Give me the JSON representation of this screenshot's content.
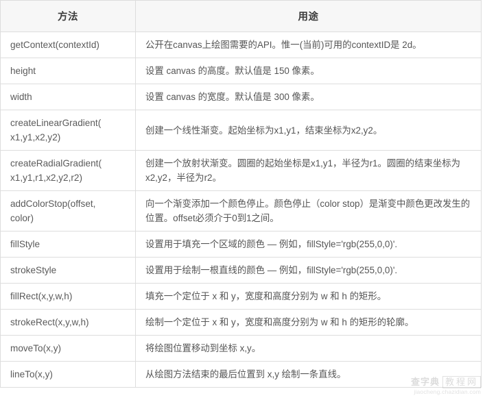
{
  "table": {
    "headers": [
      "方法",
      "用途"
    ],
    "rows": [
      {
        "method": "getContext(contextId)",
        "use": "公开在canvas上绘图需要的API。惟一(当前)可用的contextID是 2d。"
      },
      {
        "method": "height",
        "use": "设置 canvas 的高度。默认值是 150 像素。"
      },
      {
        "method": "width",
        "use": "设置 canvas 的宽度。默认值是 300 像素。"
      },
      {
        "method": "createLinearGradient(\nx1,y1,x2,y2)",
        "use": "创建一个线性渐变。起始坐标为x1,y1，结束坐标为x2,y2。"
      },
      {
        "method": "createRadialGradient(\nx1,y1,r1,x2,y2,r2)",
        "use": "创建一个放射状渐变。圆圈的起始坐标是x1,y1，半径为r1。圆圈的结束坐标为x2,y2，半径为r2。"
      },
      {
        "method": "addColorStop(offset,\ncolor)",
        "use": "向一个渐变添加一个颜色停止。颜色停止（color stop）是渐变中颜色更改发生的位置。offset必须介于0到1之间。"
      },
      {
        "method": "fillStyle",
        "use": "设置用于填充一个区域的颜色 — 例如，fillStyle='rgb(255,0,0)'."
      },
      {
        "method": "strokeStyle",
        "use": "设置用于绘制一根直线的颜色 — 例如，fillStyle='rgb(255,0,0)'."
      },
      {
        "method": "fillRect(x,y,w,h)",
        "use": "填充一个定位于 x 和 y，宽度和高度分别为 w 和 h 的矩形。"
      },
      {
        "method": "strokeRect(x,y,w,h)",
        "use": "绘制一个定位于 x 和 y，宽度和高度分别为 w 和 h 的矩形的轮廓。"
      },
      {
        "method": "moveTo(x,y)",
        "use": "将绘图位置移动到坐标 x,y。"
      },
      {
        "method": "lineTo(x,y)",
        "use": "从绘图方法结束的最后位置到 x,y 绘制一条直线。"
      }
    ]
  },
  "watermark": {
    "brand": "查字典",
    "boxed": "教程网",
    "url": "jiaocheng.chazidian.com"
  },
  "colors": {
    "header_bg": "#f7f7f7",
    "border": "#dddddd",
    "text": "#555555",
    "header_text": "#3c3c3c"
  }
}
